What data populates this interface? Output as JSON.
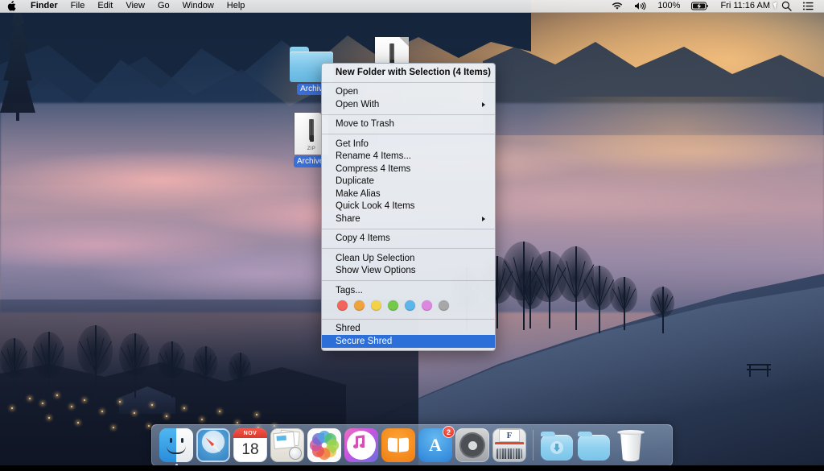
{
  "menubar": {
    "apple_icon": "apple-logo-icon",
    "items": [
      {
        "label": "Finder",
        "bold": true
      },
      {
        "label": "File",
        "bold": false
      },
      {
        "label": "Edit",
        "bold": false
      },
      {
        "label": "View",
        "bold": false
      },
      {
        "label": "Go",
        "bold": false
      },
      {
        "label": "Window",
        "bold": false
      },
      {
        "label": "Help",
        "bold": false
      }
    ],
    "status": {
      "wifi_icon": "wifi-icon",
      "volume_icon": "volume-icon",
      "battery_percent": "100%",
      "battery_icon": "battery-charging-icon",
      "clock": "Fri 11:16 AM",
      "search_icon": "search-icon",
      "notification_center_icon": "notification-center-icon"
    }
  },
  "desktop": {
    "icons": [
      {
        "name": "Archiv",
        "type": "folder",
        "selected": true
      },
      {
        "name": "Archive.",
        "type": "zip-document",
        "badge": "ZIP",
        "selected": true
      }
    ]
  },
  "context_menu": {
    "groups": [
      {
        "items": [
          {
            "label": "New Folder with Selection (4 Items)",
            "bold": true,
            "submenu": false,
            "selected": false
          }
        ]
      },
      {
        "items": [
          {
            "label": "Open",
            "bold": false,
            "submenu": false,
            "selected": false
          },
          {
            "label": "Open With",
            "bold": false,
            "submenu": true,
            "selected": false
          }
        ]
      },
      {
        "items": [
          {
            "label": "Move to Trash",
            "bold": false,
            "submenu": false,
            "selected": false
          }
        ]
      },
      {
        "items": [
          {
            "label": "Get Info",
            "bold": false,
            "submenu": false,
            "selected": false
          },
          {
            "label": "Rename 4 Items...",
            "bold": false,
            "submenu": false,
            "selected": false
          },
          {
            "label": "Compress 4 Items",
            "bold": false,
            "submenu": false,
            "selected": false
          },
          {
            "label": "Duplicate",
            "bold": false,
            "submenu": false,
            "selected": false
          },
          {
            "label": "Make Alias",
            "bold": false,
            "submenu": false,
            "selected": false
          },
          {
            "label": "Quick Look 4 Items",
            "bold": false,
            "submenu": false,
            "selected": false
          },
          {
            "label": "Share",
            "bold": false,
            "submenu": true,
            "selected": false
          }
        ]
      },
      {
        "items": [
          {
            "label": "Copy 4 Items",
            "bold": false,
            "submenu": false,
            "selected": false
          }
        ]
      },
      {
        "items": [
          {
            "label": "Clean Up Selection",
            "bold": false,
            "submenu": false,
            "selected": false
          },
          {
            "label": "Show View Options",
            "bold": false,
            "submenu": false,
            "selected": false
          }
        ]
      },
      {
        "items": [
          {
            "label": "Tags...",
            "bold": false,
            "submenu": false,
            "selected": false
          }
        ],
        "tags": [
          "#f2655a",
          "#f0a33c",
          "#f2d14b",
          "#74c94b",
          "#5ab7ec",
          "#dd88e0",
          "#a7a7a7"
        ]
      },
      {
        "items": [
          {
            "label": "Shred",
            "bold": false,
            "submenu": false,
            "selected": false
          },
          {
            "label": "Secure Shred",
            "bold": false,
            "submenu": false,
            "selected": true
          }
        ]
      }
    ],
    "highlight_color": "#2d6fd8"
  },
  "dock": {
    "items": [
      {
        "label": "Finder",
        "icon": "finder-icon",
        "running": true,
        "badge": null
      },
      {
        "label": "Safari",
        "icon": "safari-icon",
        "running": false,
        "badge": null
      },
      {
        "label": "Calendar",
        "icon": "calendar-icon",
        "running": false,
        "badge": null,
        "month": "NOV",
        "day": "18"
      },
      {
        "label": "Mail",
        "icon": "mail-icon",
        "running": false,
        "badge": null
      },
      {
        "label": "Photos",
        "icon": "photos-icon",
        "running": false,
        "badge": null
      },
      {
        "label": "iTunes",
        "icon": "itunes-icon",
        "running": false,
        "badge": null
      },
      {
        "label": "iBooks",
        "icon": "ibooks-icon",
        "running": false,
        "badge": null
      },
      {
        "label": "App Store",
        "icon": "app-store-icon",
        "running": false,
        "badge": "2"
      },
      {
        "label": "System Preferences",
        "icon": "system-preferences-icon",
        "running": false,
        "badge": null
      },
      {
        "label": "Shredder",
        "icon": "shredder-icon",
        "running": false,
        "badge": null,
        "paper_letter": "F"
      }
    ],
    "right_items": [
      {
        "label": "Downloads",
        "icon": "downloads-folder-icon"
      },
      {
        "label": "Documents",
        "icon": "folder-icon"
      },
      {
        "label": "Trash",
        "icon": "trash-icon"
      }
    ]
  }
}
